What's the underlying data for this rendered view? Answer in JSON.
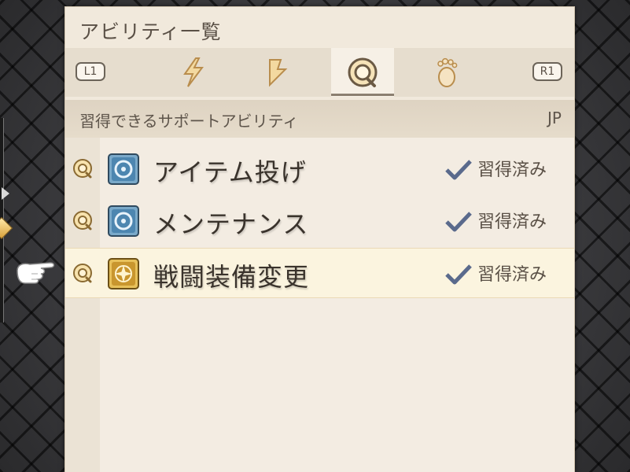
{
  "panel": {
    "title": "アビリティ一覧"
  },
  "tabs": {
    "left_key": "L1",
    "right_key": "R1",
    "items": [
      {
        "icon": "lightning-icon",
        "active": false
      },
      {
        "icon": "lightning-alt-icon",
        "active": false
      },
      {
        "icon": "support-ability-icon",
        "active": true
      },
      {
        "icon": "foot-icon",
        "active": false
      }
    ]
  },
  "section": {
    "title": "習得できるサポートアビリティ",
    "jp_label": "JP"
  },
  "abilities": [
    {
      "name": "アイテム投げ",
      "icon": "blue-ring-icon",
      "status": "習得済み",
      "selected": false
    },
    {
      "name": "メンテナンス",
      "icon": "blue-ring-icon",
      "status": "習得済み",
      "selected": false
    },
    {
      "name": "戦闘装備変更",
      "icon": "gold-star-icon",
      "status": "習得済み",
      "selected": true
    }
  ],
  "colors": {
    "panel_bg": "#f1e9dc",
    "accent_gold": "#d8a13b",
    "check_blue": "#5a6a8c"
  }
}
